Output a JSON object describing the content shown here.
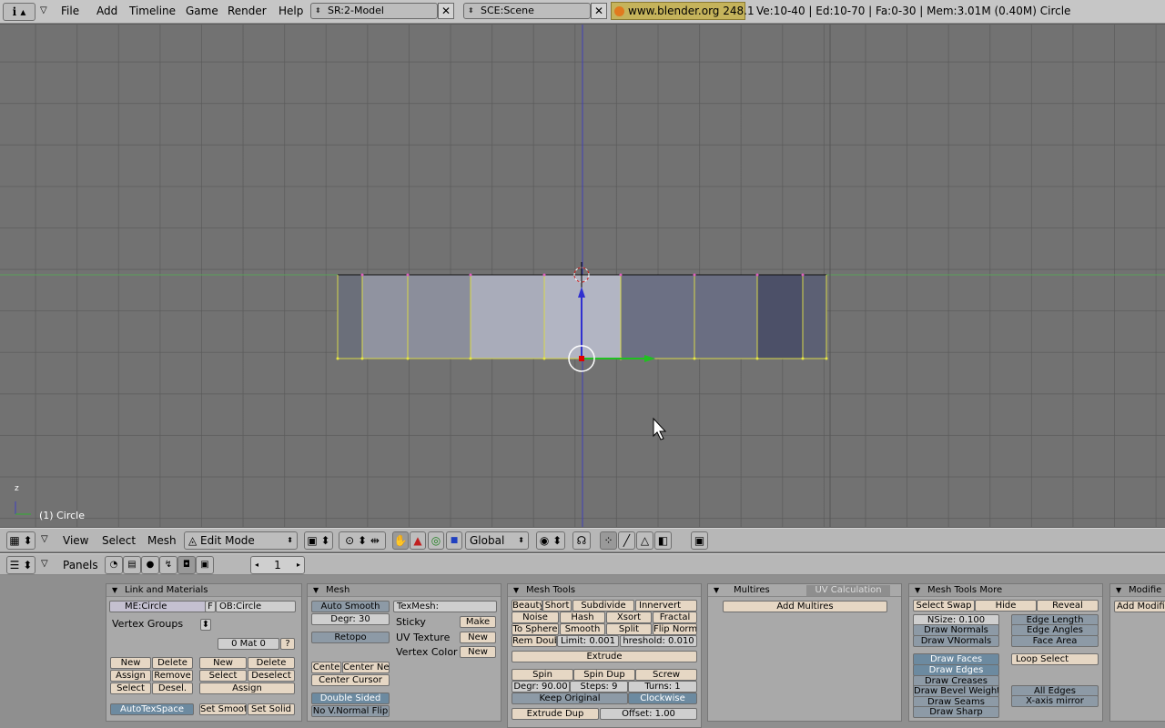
{
  "topbar": {
    "menus": [
      "File",
      "Add",
      "Timeline",
      "Game",
      "Render",
      "Help"
    ],
    "screen": "SR:2-Model",
    "scene": "SCE:Scene",
    "url": "www.blender.org 248.1",
    "stats": "Ve:10-40 | Ed:10-70 | Fa:0-30 | Mem:3.01M (0.40M) Circle"
  },
  "viewport": {
    "object_label": "(1) Circle",
    "axis_label": "z"
  },
  "view3d_header": {
    "menus": [
      "View",
      "Select",
      "Mesh"
    ],
    "mode": "Edit Mode",
    "orientation": "Global"
  },
  "buttons_header": {
    "panels_label": "Panels",
    "frame": "1"
  },
  "link_materials": {
    "title": "Link and Materials",
    "me": "ME:Circle",
    "f": "F",
    "ob": "OB:Circle",
    "vertex_groups": "Vertex Groups",
    "mat": "0 Mat 0",
    "q": "?",
    "vg_new": "New",
    "vg_delete": "Delete",
    "vg_assign": "Assign",
    "vg_remove": "Remove",
    "vg_select": "Select",
    "vg_desel": "Desel.",
    "m_new": "New",
    "m_delete": "Delete",
    "m_select": "Select",
    "m_deselect": "Deselect",
    "m_assign": "Assign",
    "autotex": "AutoTexSpace",
    "set_smooth": "Set Smoot",
    "set_solid": "Set Solid"
  },
  "mesh": {
    "title": "Mesh",
    "auto_smooth": "Auto Smooth",
    "degr": "Degr: 30",
    "retopo": "Retopo",
    "centre": "Cente",
    "centre_new": "Center Ne",
    "centre_cursor": "Center Cursor",
    "double_sided": "Double Sided",
    "no_vnormal": "No V.Normal Flip",
    "texmesh": "TexMesh:",
    "sticky": "Sticky",
    "make": "Make",
    "uv_texture": "UV Texture",
    "uv_new": "New",
    "vertex_color": "Vertex Color",
    "vc_new": "New"
  },
  "mesh_tools": {
    "title": "Mesh Tools",
    "beauty": "Beauty",
    "short": "Short",
    "subdivide": "Subdivide",
    "innervert": "Innervert",
    "noise": "Noise",
    "hash": "Hash",
    "xsort": "Xsort",
    "fractal": "Fractal",
    "to_sphere": "To Sphere",
    "smooth": "Smooth",
    "split": "Split",
    "flip_normals": "Flip Norma",
    "rem_doubles": "Rem Doub",
    "limit": "Limit: 0.001",
    "threshold": "hreshold: 0.010",
    "extrude": "Extrude",
    "spin": "Spin",
    "spin_dup": "Spin Dup",
    "screw": "Screw",
    "spin_degr": "Degr: 90.00",
    "steps": "Steps: 9",
    "turns": "Turns: 1",
    "keep_original": "Keep Original",
    "clockwise": "Clockwise",
    "extrude_dup": "Extrude Dup",
    "offset": "Offset: 1.00"
  },
  "multires": {
    "tab1": "Multires",
    "tab2": "UV Calculation",
    "add": "Add Multires"
  },
  "mesh_tools_more": {
    "title": "Mesh Tools More",
    "select_swap": "Select Swap",
    "hide": "Hide",
    "reveal": "Reveal",
    "nsize": "NSize: 0.100",
    "draw_normals": "Draw Normals",
    "draw_vnormals": "Draw VNormals",
    "edge_length": "Edge Length",
    "edge_angles": "Edge Angles",
    "face_area": "Face Area",
    "draw_faces": "Draw Faces",
    "draw_edges": "Draw Edges",
    "draw_creases": "Draw Creases",
    "draw_bevel": "Draw Bevel Weights",
    "draw_seams": "Draw Seams",
    "draw_sharp": "Draw Sharp",
    "loop_select": "Loop Select",
    "all_edges": "All Edges",
    "xmirror": "X-axis mirror"
  },
  "modifiers": {
    "title": "Modifie",
    "add": "Add Modifie"
  }
}
